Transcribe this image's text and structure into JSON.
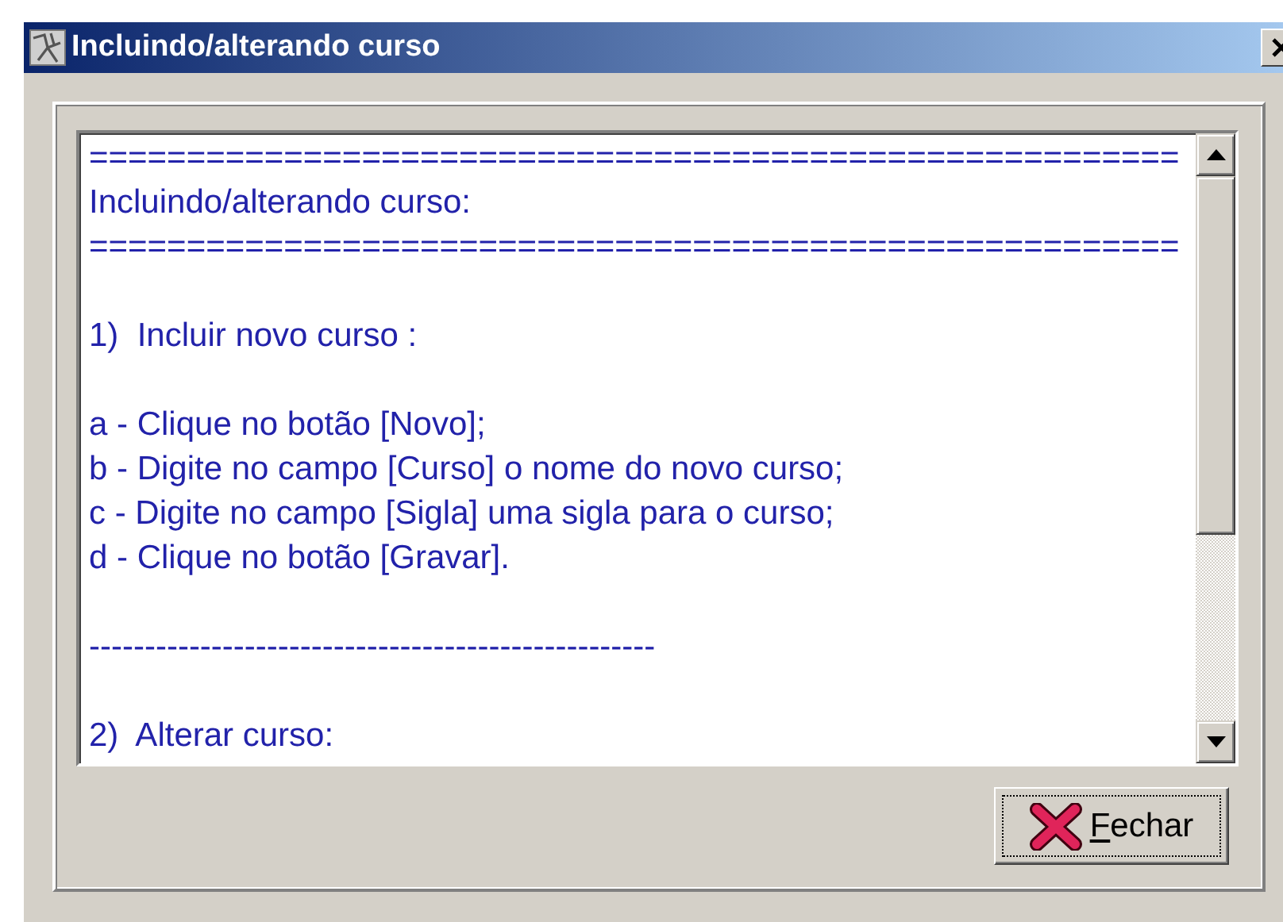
{
  "window": {
    "title": "Incluindo/alterando curso"
  },
  "memo": {
    "paragraphs": [
      [
        "========================================================",
        "Incluindo/alterando curso:",
        "========================================================"
      ],
      [
        "1)  Incluir novo curso :"
      ],
      [
        "a - Clique no botão [Novo];",
        "b - Digite no campo [Curso] o nome do novo curso;",
        "c - Digite no campo [Sigla] uma sigla para o curso;",
        "d - Clique no botão [Gravar]."
      ],
      [
        "---------------------------------------------------"
      ],
      [
        "2)  Alterar curso:"
      ]
    ]
  },
  "buttons": [
    {
      "label": "Fechar",
      "focused": true
    }
  ]
}
